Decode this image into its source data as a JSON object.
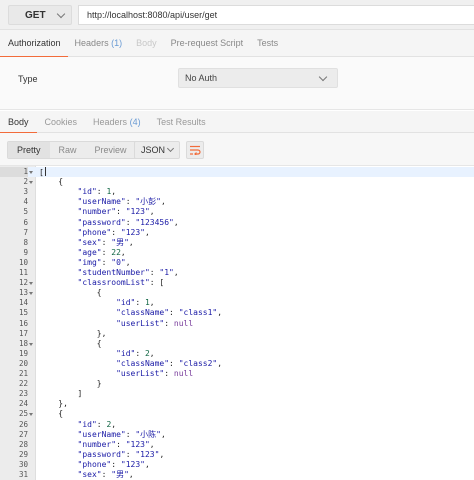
{
  "request": {
    "method": "GET",
    "url": "http://localhost:8080/api/user/get"
  },
  "request_tabs": [
    {
      "id": "authorization",
      "label": "Authorization",
      "active": true,
      "disabled": false
    },
    {
      "id": "headers",
      "label": "Headers",
      "count": "(1)",
      "active": false,
      "disabled": false
    },
    {
      "id": "body",
      "label": "Body",
      "active": false,
      "disabled": true
    },
    {
      "id": "pre-request-script",
      "label": "Pre-request Script",
      "active": false,
      "disabled": false
    },
    {
      "id": "tests",
      "label": "Tests",
      "active": false,
      "disabled": false
    }
  ],
  "auth": {
    "type_label": "Type",
    "type_value": "No Auth"
  },
  "response_tabs": [
    {
      "id": "body",
      "label": "Body",
      "active": true
    },
    {
      "id": "cookies",
      "label": "Cookies",
      "active": false
    },
    {
      "id": "headers",
      "label": "Headers",
      "count": "(4)",
      "active": false
    },
    {
      "id": "test-results",
      "label": "Test Results",
      "active": false
    }
  ],
  "view_modes": [
    {
      "id": "pretty",
      "label": "Pretty",
      "active": true
    },
    {
      "id": "raw",
      "label": "Raw",
      "active": false
    },
    {
      "id": "preview",
      "label": "Preview",
      "active": false
    }
  ],
  "format": "JSON",
  "icons": {
    "method_dropdown": "chevron-down-icon",
    "auth_dropdown": "chevron-down-icon",
    "format_dropdown": "chevron-down-icon",
    "wrap": "wrap-lines-icon",
    "fold": "fold-arrow-icon"
  },
  "colors": {
    "accent": "#f26b3a",
    "count": "#6a9bd4",
    "key": "#1a1aa6",
    "number": "#116644",
    "keyword": "#7a3e9d"
  },
  "code_lines": [
    {
      "n": "1",
      "fold": true,
      "segs": [
        [
          "p",
          "["
        ]
      ]
    },
    {
      "n": "2",
      "fold": true,
      "segs": [
        [
          "p",
          "    {"
        ]
      ]
    },
    {
      "n": "3",
      "segs": [
        [
          "p",
          "        "
        ],
        [
          "k",
          "\"id\""
        ],
        [
          "p",
          ": "
        ],
        [
          "n",
          "1"
        ],
        [
          "p",
          ","
        ]
      ]
    },
    {
      "n": "4",
      "segs": [
        [
          "p",
          "        "
        ],
        [
          "k",
          "\"userName\""
        ],
        [
          "p",
          ": "
        ],
        [
          "s",
          "\"小彭\""
        ],
        [
          "p",
          ","
        ]
      ]
    },
    {
      "n": "5",
      "segs": [
        [
          "p",
          "        "
        ],
        [
          "k",
          "\"number\""
        ],
        [
          "p",
          ": "
        ],
        [
          "s",
          "\"123\""
        ],
        [
          "p",
          ","
        ]
      ]
    },
    {
      "n": "6",
      "segs": [
        [
          "p",
          "        "
        ],
        [
          "k",
          "\"password\""
        ],
        [
          "p",
          ": "
        ],
        [
          "s",
          "\"123456\""
        ],
        [
          "p",
          ","
        ]
      ]
    },
    {
      "n": "7",
      "segs": [
        [
          "p",
          "        "
        ],
        [
          "k",
          "\"phone\""
        ],
        [
          "p",
          ": "
        ],
        [
          "s",
          "\"123\""
        ],
        [
          "p",
          ","
        ]
      ]
    },
    {
      "n": "8",
      "segs": [
        [
          "p",
          "        "
        ],
        [
          "k",
          "\"sex\""
        ],
        [
          "p",
          ": "
        ],
        [
          "s",
          "\"男\""
        ],
        [
          "p",
          ","
        ]
      ]
    },
    {
      "n": "9",
      "segs": [
        [
          "p",
          "        "
        ],
        [
          "k",
          "\"age\""
        ],
        [
          "p",
          ": "
        ],
        [
          "n",
          "22"
        ],
        [
          "p",
          ","
        ]
      ]
    },
    {
      "n": "10",
      "segs": [
        [
          "p",
          "        "
        ],
        [
          "k",
          "\"img\""
        ],
        [
          "p",
          ": "
        ],
        [
          "s",
          "\"0\""
        ],
        [
          "p",
          ","
        ]
      ]
    },
    {
      "n": "11",
      "segs": [
        [
          "p",
          "        "
        ],
        [
          "k",
          "\"studentNumber\""
        ],
        [
          "p",
          ": "
        ],
        [
          "s",
          "\"1\""
        ],
        [
          "p",
          ","
        ]
      ]
    },
    {
      "n": "12",
      "fold": true,
      "segs": [
        [
          "p",
          "        "
        ],
        [
          "k",
          "\"classroomList\""
        ],
        [
          "p",
          ": ["
        ]
      ]
    },
    {
      "n": "13",
      "fold": true,
      "segs": [
        [
          "p",
          "            {"
        ]
      ]
    },
    {
      "n": "14",
      "segs": [
        [
          "p",
          "                "
        ],
        [
          "k",
          "\"id\""
        ],
        [
          "p",
          ": "
        ],
        [
          "n",
          "1"
        ],
        [
          "p",
          ","
        ]
      ]
    },
    {
      "n": "15",
      "segs": [
        [
          "p",
          "                "
        ],
        [
          "k",
          "\"className\""
        ],
        [
          "p",
          ": "
        ],
        [
          "s",
          "\"class1\""
        ],
        [
          "p",
          ","
        ]
      ]
    },
    {
      "n": "16",
      "segs": [
        [
          "p",
          "                "
        ],
        [
          "k",
          "\"userList\""
        ],
        [
          "p",
          ": "
        ],
        [
          "w",
          "null"
        ]
      ]
    },
    {
      "n": "17",
      "segs": [
        [
          "p",
          "            },"
        ]
      ]
    },
    {
      "n": "18",
      "fold": true,
      "segs": [
        [
          "p",
          "            {"
        ]
      ]
    },
    {
      "n": "19",
      "segs": [
        [
          "p",
          "                "
        ],
        [
          "k",
          "\"id\""
        ],
        [
          "p",
          ": "
        ],
        [
          "n",
          "2"
        ],
        [
          "p",
          ","
        ]
      ]
    },
    {
      "n": "20",
      "segs": [
        [
          "p",
          "                "
        ],
        [
          "k",
          "\"className\""
        ],
        [
          "p",
          ": "
        ],
        [
          "s",
          "\"class2\""
        ],
        [
          "p",
          ","
        ]
      ]
    },
    {
      "n": "21",
      "segs": [
        [
          "p",
          "                "
        ],
        [
          "k",
          "\"userList\""
        ],
        [
          "p",
          ": "
        ],
        [
          "w",
          "null"
        ]
      ]
    },
    {
      "n": "22",
      "segs": [
        [
          "p",
          "            }"
        ]
      ]
    },
    {
      "n": "23",
      "segs": [
        [
          "p",
          "        ]"
        ]
      ]
    },
    {
      "n": "24",
      "segs": [
        [
          "p",
          "    },"
        ]
      ]
    },
    {
      "n": "25",
      "fold": true,
      "segs": [
        [
          "p",
          "    {"
        ]
      ]
    },
    {
      "n": "26",
      "segs": [
        [
          "p",
          "        "
        ],
        [
          "k",
          "\"id\""
        ],
        [
          "p",
          ": "
        ],
        [
          "n",
          "2"
        ],
        [
          "p",
          ","
        ]
      ]
    },
    {
      "n": "27",
      "segs": [
        [
          "p",
          "        "
        ],
        [
          "k",
          "\"userName\""
        ],
        [
          "p",
          ": "
        ],
        [
          "s",
          "\"小陈\""
        ],
        [
          "p",
          ","
        ]
      ]
    },
    {
      "n": "28",
      "segs": [
        [
          "p",
          "        "
        ],
        [
          "k",
          "\"number\""
        ],
        [
          "p",
          ": "
        ],
        [
          "s",
          "\"123\""
        ],
        [
          "p",
          ","
        ]
      ]
    },
    {
      "n": "29",
      "segs": [
        [
          "p",
          "        "
        ],
        [
          "k",
          "\"password\""
        ],
        [
          "p",
          ": "
        ],
        [
          "s",
          "\"123\""
        ],
        [
          "p",
          ","
        ]
      ]
    },
    {
      "n": "30",
      "segs": [
        [
          "p",
          "        "
        ],
        [
          "k",
          "\"phone\""
        ],
        [
          "p",
          ": "
        ],
        [
          "s",
          "\"123\""
        ],
        [
          "p",
          ","
        ]
      ]
    },
    {
      "n": "31",
      "segs": [
        [
          "p",
          "        "
        ],
        [
          "k",
          "\"sex\""
        ],
        [
          "p",
          ": "
        ],
        [
          "s",
          "\"男\""
        ],
        [
          "p",
          ","
        ]
      ]
    }
  ]
}
